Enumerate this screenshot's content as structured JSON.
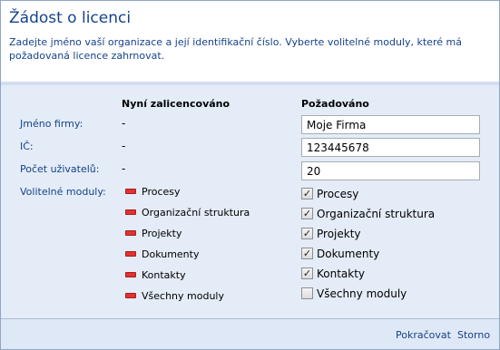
{
  "dialog": {
    "title": "Žádost o licenci",
    "description": "Zadejte jméno vaší organizace a její identifikační číslo. Vyberte volitelné moduly, které má požadovaná licence zahrnovat."
  },
  "columns": {
    "current": "Nyní zalicencováno",
    "requested": "Požadováno"
  },
  "fields": [
    {
      "label": "Jméno firmy:",
      "current": "-",
      "requested": "Moje Firma"
    },
    {
      "label": "IČ:",
      "current": "-",
      "requested": "123445678"
    },
    {
      "label": "Počet uživatelů:",
      "current": "-",
      "requested": "20"
    }
  ],
  "modules_label": "Volitelné moduly:",
  "modules": [
    {
      "name": "Procesy",
      "licensed": false,
      "requested": true
    },
    {
      "name": "Organizační struktura",
      "licensed": false,
      "requested": true
    },
    {
      "name": "Projekty",
      "licensed": false,
      "requested": true
    },
    {
      "name": "Dokumenty",
      "licensed": false,
      "requested": true
    },
    {
      "name": "Kontakty",
      "licensed": false,
      "requested": true
    },
    {
      "name": "Všechny moduly",
      "licensed": false,
      "requested": false
    }
  ],
  "icons": {
    "not_licensed": "minus-icon",
    "checked": "checkbox-checked-icon",
    "unchecked": "checkbox-unchecked-icon"
  },
  "colors": {
    "title": "#15428b",
    "panel_bg": "#e4ecf7",
    "minus_icon": "#e23232"
  },
  "footer": {
    "continue_label": "Pokračovat",
    "cancel_label": "Storno"
  }
}
